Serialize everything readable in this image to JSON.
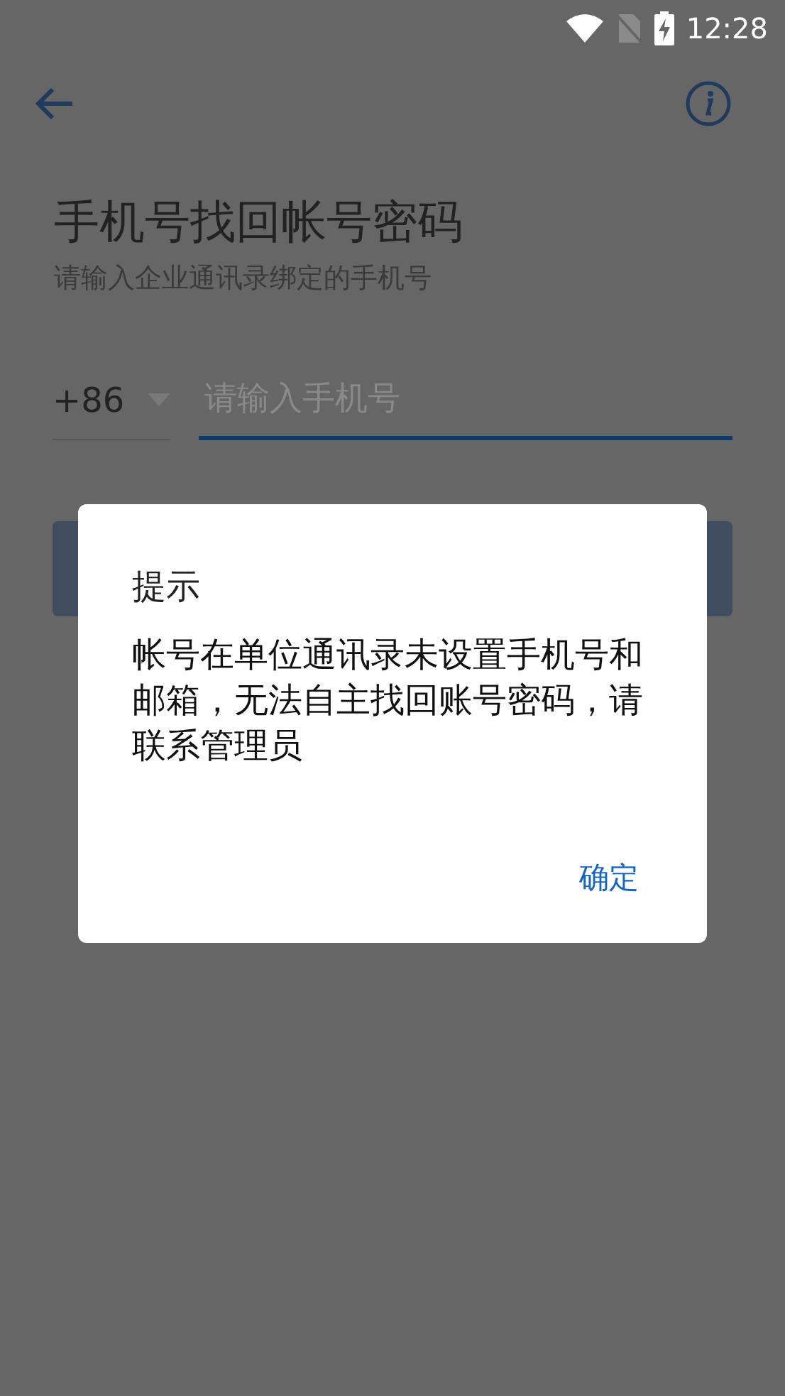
{
  "status_bar": {
    "time": "12:28"
  },
  "title": "手机号找回帐号密码",
  "subtitle": "请输入企业通讯录绑定的手机号",
  "phone": {
    "country_code": "+86",
    "placeholder": "请输入手机号",
    "focused": true
  },
  "dialog": {
    "title": "提示",
    "message": "帐号在单位通讯录未设置手机号和邮箱，无法自主找回账号密码，请联系管理员",
    "buttons": [
      "确定"
    ]
  }
}
